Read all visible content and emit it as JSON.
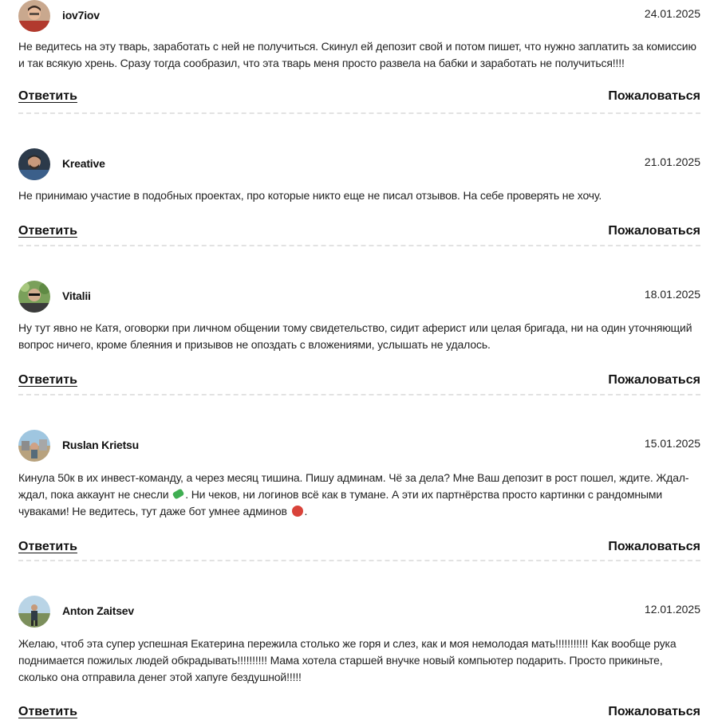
{
  "actions": {
    "reply_label": "Ответить",
    "report_label": "Пожаловаться"
  },
  "comments": [
    {
      "author": "iov7iov",
      "date": "24.01.2025",
      "text": "Не ведитесь на эту тварь, заработать с ней не получиться. Скинул ей депозит свой и потом пишет, что нужно заплатить за комиссию и так всякую хрень. Сразу тогда сообразил, что эта тварь меня просто развела на бабки и заработать не получиться!!!!"
    },
    {
      "author": "Kreative",
      "date": "21.01.2025",
      "text": "Не принимаю участие в подобных проектах, про которые никто еще не писал отзывов. На себе проверять не хочу."
    },
    {
      "author": "Vitalii",
      "date": "18.01.2025",
      "text": "Ну тут явно не Катя, оговорки при личном общении тому свидетельство, сидит аферист или целая бригада, ни на один уточняющий вопрос ничего, кроме блеяния и призывов не опоздать с вложениями, услышать не удалось."
    },
    {
      "author": "Ruslan Krietsu",
      "date": "15.01.2025",
      "text_part1": "Кинула 50к в их инвест-команду, а через месяц тишина. Пишу админам. Чё за дела? Мне Ваш депозит в рост пошел, ждите. Ждал-ждал, пока аккаунт не снесли ",
      "emoji1": "money-with-wings-emoji",
      "text_part2": ". Ни чеков, ни логинов всё как в тумане. А эти их партнёрства просто картинки с рандомными чуваками! Не ведитесь, тут даже бот умнее админов ",
      "emoji2": "angry-face-emoji",
      "text_part3": "."
    },
    {
      "author": "Anton Zaitsev",
      "date": "12.01.2025",
      "text": "Желаю, чтоб эта супер успешная Екатерина пережила столько же горя и слез, как и моя немолодая мать!!!!!!!!!!! Как вообще рука поднимается пожилых людей обкрадывать!!!!!!!!!! Мама хотела старшей внучке новый компьютер подарить. Просто прикиньте, сколько она отправила денег этой хапуге бездушной!!!!!"
    }
  ]
}
